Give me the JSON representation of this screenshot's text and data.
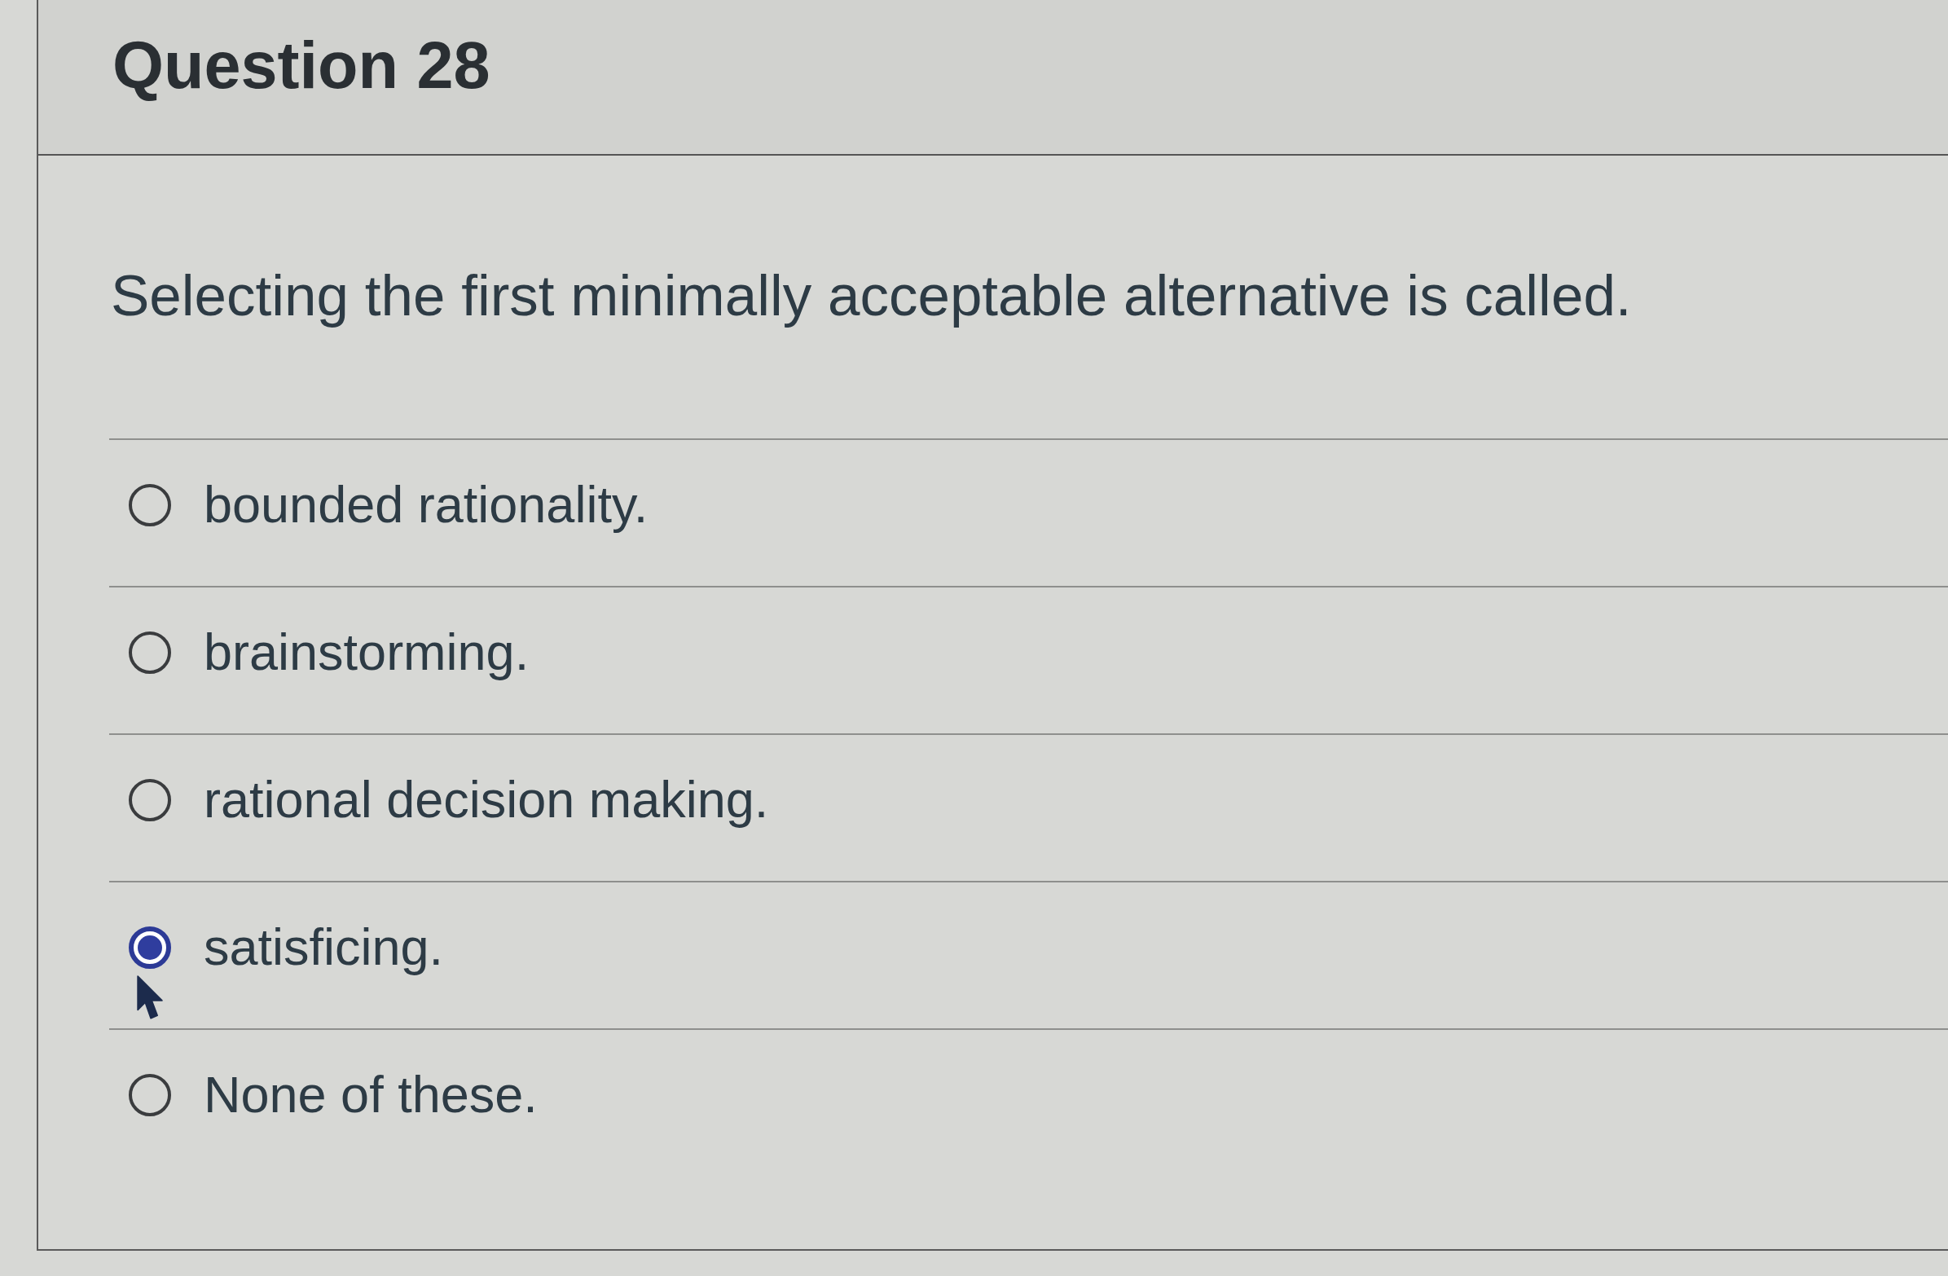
{
  "question": {
    "title": "Question 28",
    "text": "Selecting the first minimally acceptable alternative is called."
  },
  "answers": [
    {
      "label": "bounded rationality.",
      "selected": false
    },
    {
      "label": "brainstorming.",
      "selected": false
    },
    {
      "label": "rational decision making.",
      "selected": false
    },
    {
      "label": "satisficing.",
      "selected": true
    },
    {
      "label": "None of these.",
      "selected": false
    }
  ]
}
